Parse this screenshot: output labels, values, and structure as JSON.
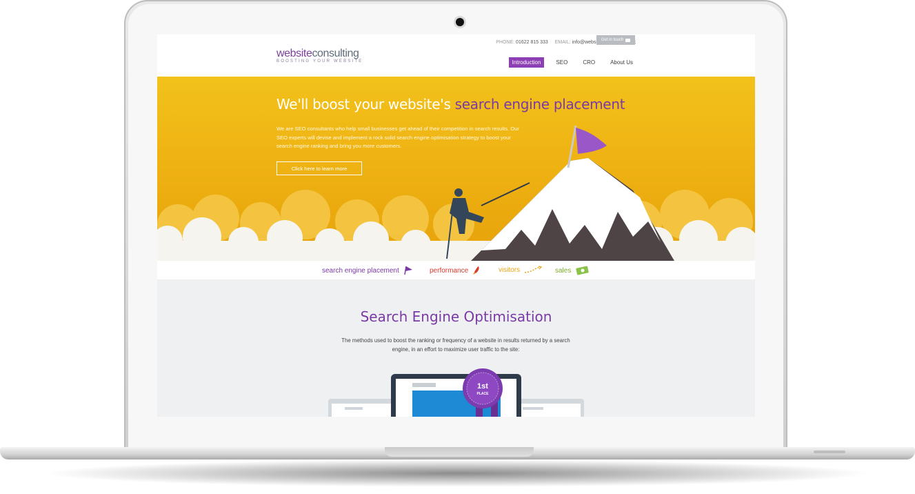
{
  "site": {
    "topbar": {
      "phone_label": "PHONE:",
      "phone_value": "01622 815 333",
      "email_label": "EMAIL:",
      "email_value": "info@websiteconsulting.co.uk",
      "contact_button": "Get in touch"
    },
    "logo": {
      "part1": "website",
      "part2": "consulting",
      "tagline": "BOOSTING YOUR WEBSITE"
    },
    "nav": {
      "items": [
        "Introduction",
        "SEO",
        "CRO",
        "About Us"
      ],
      "active": "Introduction"
    }
  },
  "hero": {
    "title_plain": "We'll boost your website's ",
    "title_accent": "search engine placement",
    "description": "We  are SEO consultants who help small businesses get ahead of their  competition in search results. Our SEO experts will devise and implement  a rock solid search engine optimisation strategy to boost your search engine ranking and bring you  more customers.",
    "cta": "Click here to learn more"
  },
  "features": [
    {
      "label": "search engine placement",
      "icon": "flag-icon",
      "color": "#7a3aa6"
    },
    {
      "label": "performance",
      "icon": "rocket-icon",
      "color": "#d73a2b"
    },
    {
      "label": "visitors",
      "icon": "dotted-arrow-icon",
      "color": "#e8a512"
    },
    {
      "label": "sales",
      "icon": "money-icon",
      "color": "#7cab2c"
    }
  ],
  "section": {
    "title": "Search Engine Optimisation",
    "description": "The methods used to boost the ranking or frequency of a website in results returned by a search engine, in an effort to maximize user traffic to the site:",
    "badge_line1": "1st",
    "badge_line2": "PLACE"
  },
  "colors": {
    "brand_purple": "#7a3aa6",
    "hero_yellow": "#efb313",
    "nav_active": "#8d3fb5"
  }
}
